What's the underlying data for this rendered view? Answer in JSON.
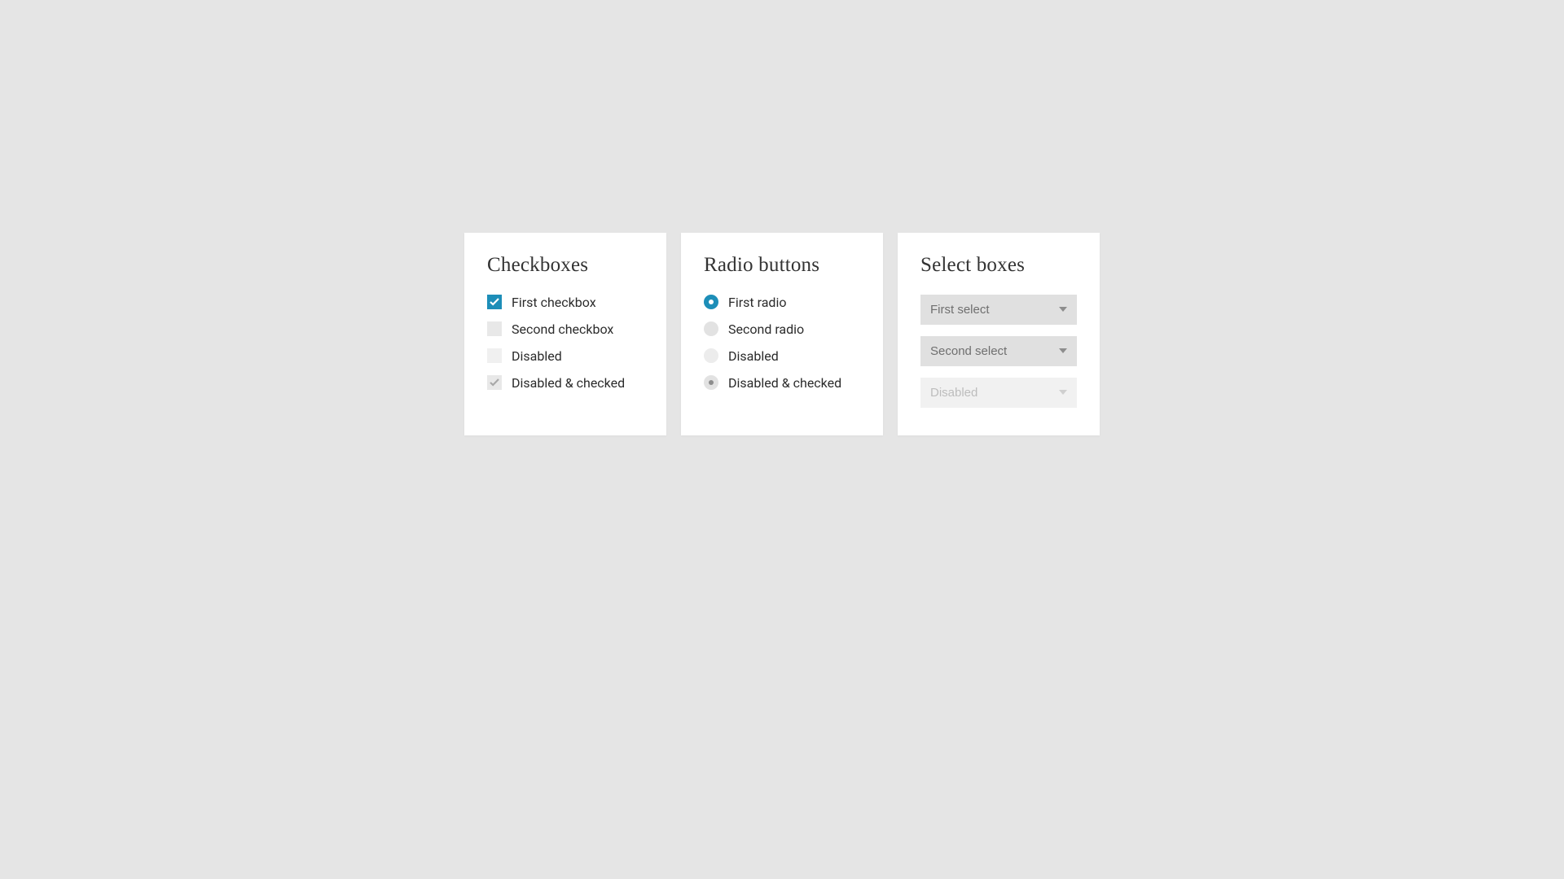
{
  "checkboxes": {
    "title": "Checkboxes",
    "items": [
      {
        "label": "First checkbox"
      },
      {
        "label": "Second checkbox"
      },
      {
        "label": "Disabled"
      },
      {
        "label": "Disabled & checked"
      }
    ]
  },
  "radios": {
    "title": "Radio buttons",
    "items": [
      {
        "label": "First radio"
      },
      {
        "label": "Second radio"
      },
      {
        "label": "Disabled"
      },
      {
        "label": "Disabled & checked"
      }
    ]
  },
  "selects": {
    "title": "Select boxes",
    "items": [
      {
        "label": "First select"
      },
      {
        "label": "Second select"
      },
      {
        "label": "Disabled"
      }
    ]
  },
  "colors": {
    "accent": "#1d8eb8",
    "card_bg": "#ffffff",
    "page_bg": "#e5e5e5"
  }
}
